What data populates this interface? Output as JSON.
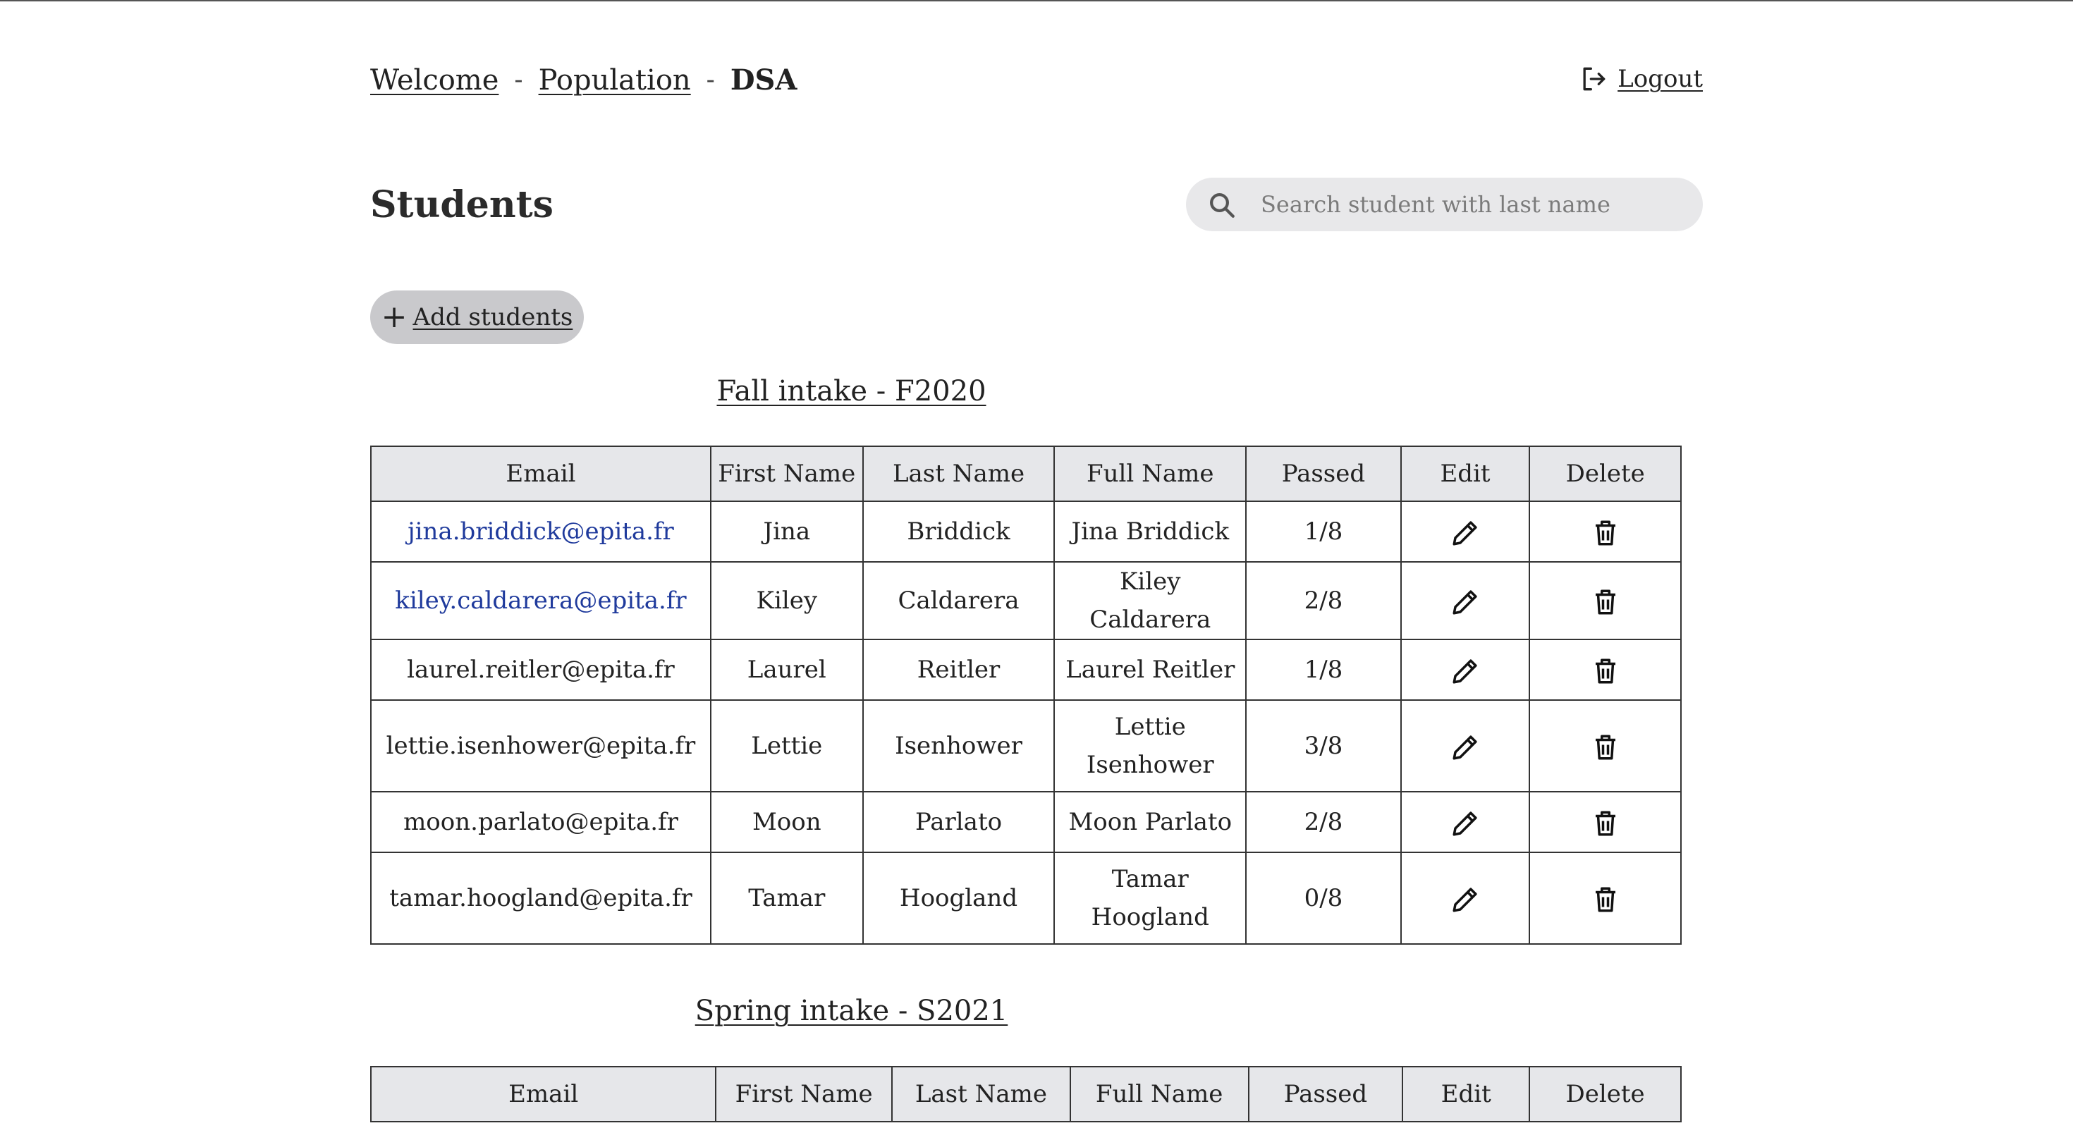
{
  "header": {
    "breadcrumb": [
      {
        "label": "Welcome"
      },
      {
        "label": "Population"
      },
      {
        "label": "DSA"
      }
    ],
    "separator": "-",
    "logout_label": "Logout",
    "logout_icon": "logout-icon"
  },
  "page": {
    "title": "Students",
    "search_placeholder": "Search student with last name",
    "search_icon": "search-icon",
    "add_button_label": "Add students"
  },
  "colors": {
    "link_email": "#1f3a9c",
    "header_bg": "#e6e7ea",
    "button_bg": "#c9c9cc",
    "search_bg": "#e8e8ea"
  },
  "columns": [
    "Email",
    "First Name",
    "Last Name",
    "Full Name",
    "Passed",
    "Edit",
    "Delete"
  ],
  "intakes": [
    {
      "title": "Fall intake - F2020",
      "students": [
        {
          "email": "jina.briddick@epita.fr",
          "first": "Jina",
          "last": "Briddick",
          "full": "Jina Briddick",
          "passed": "1/8"
        },
        {
          "email": "kiley.caldarera@epita.fr",
          "first": "Kiley",
          "last": "Caldarera",
          "full": "Kiley Caldarera",
          "passed": "2/8"
        },
        {
          "email": "laurel.reitler@epita.fr",
          "first": "Laurel",
          "last": "Reitler",
          "full": "Laurel Reitler",
          "passed": "1/8"
        },
        {
          "email": "lettie.isenhower@epita.fr",
          "first": "Lettie",
          "last": "Isenhower",
          "full": "Lettie Isenhower",
          "passed": "3/8"
        },
        {
          "email": "moon.parlato@epita.fr",
          "first": "Moon",
          "last": "Parlato",
          "full": "Moon Parlato",
          "passed": "2/8"
        },
        {
          "email": "tamar.hoogland@epita.fr",
          "first": "Tamar",
          "last": "Hoogland",
          "full": "Tamar Hoogland",
          "passed": "0/8"
        }
      ]
    },
    {
      "title": "Spring intake - S2021",
      "students": []
    }
  ]
}
